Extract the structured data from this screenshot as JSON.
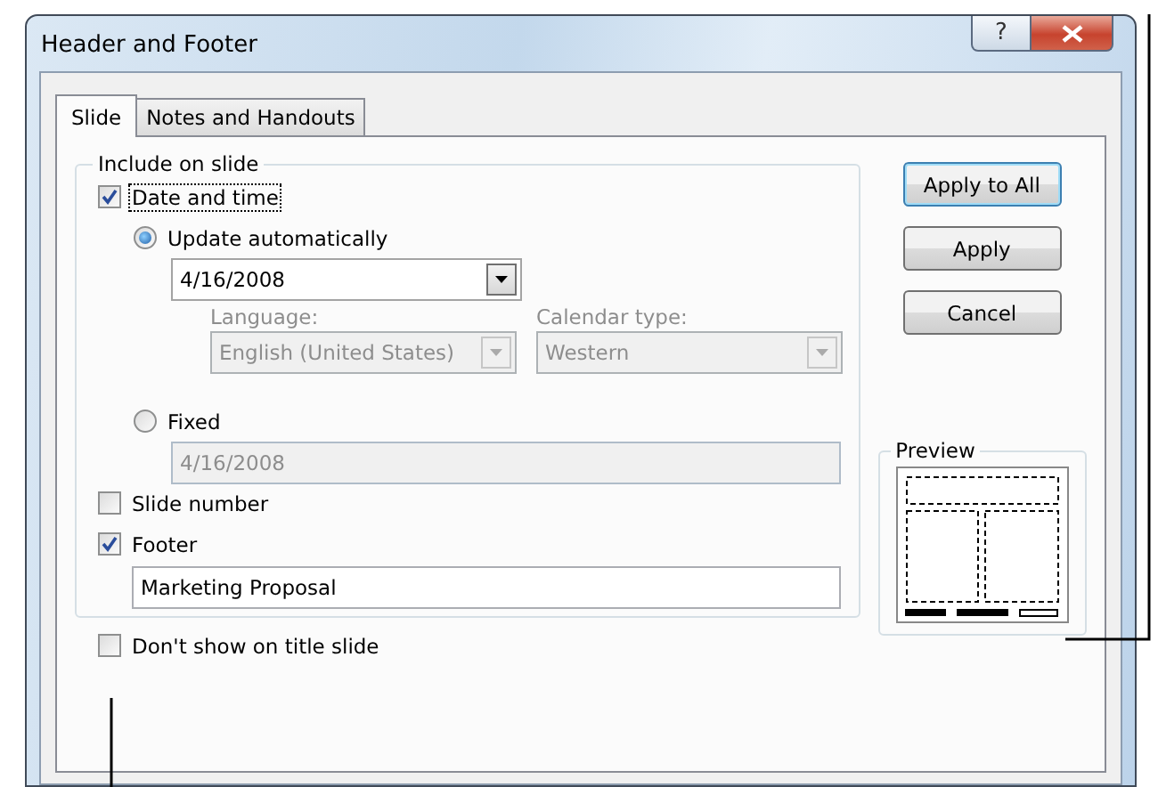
{
  "window": {
    "title": "Header and Footer",
    "help_label": "?"
  },
  "tabs": [
    {
      "label": "Slide",
      "selected": true
    },
    {
      "label": "Notes and Handouts",
      "selected": false
    }
  ],
  "include_group": {
    "title": "Include on slide",
    "date_and_time": {
      "label": "Date and time",
      "checked": true,
      "focused": true
    },
    "update_automatically": {
      "label": "Update automatically",
      "selected": true
    },
    "date_dropdown": {
      "value": "4/16/2008",
      "disabled": false
    },
    "language": {
      "label": "Language:",
      "value": "English (United States)",
      "disabled": true
    },
    "calendar_type": {
      "label": "Calendar type:",
      "value": "Western",
      "disabled": true
    },
    "fixed": {
      "label": "Fixed",
      "selected": false
    },
    "fixed_field": {
      "value": "4/16/2008",
      "disabled": true
    },
    "slide_number": {
      "label": "Slide number",
      "checked": false
    },
    "footer": {
      "label": "Footer",
      "checked": true
    },
    "footer_field": {
      "value": "Marketing Proposal"
    }
  },
  "dont_show_on_title_slide": {
    "label": "Don't show on title slide",
    "checked": false
  },
  "buttons": [
    {
      "label": "Apply to All",
      "default": true
    },
    {
      "label": "Apply",
      "default": false
    },
    {
      "label": "Cancel",
      "default": false
    }
  ],
  "preview": {
    "title": "Preview"
  }
}
